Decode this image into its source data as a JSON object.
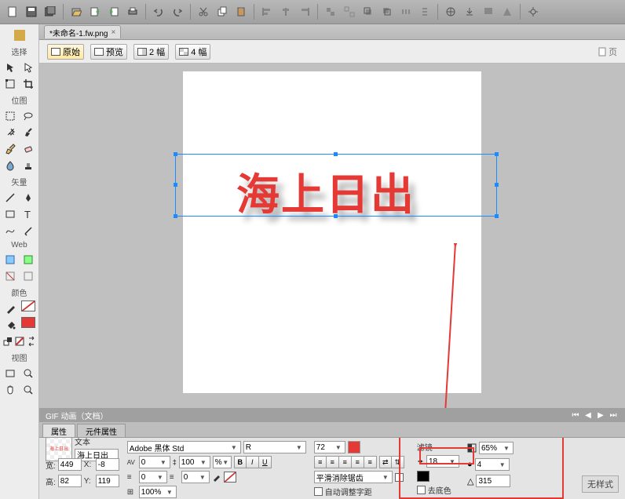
{
  "toolbar_icons": [
    "new",
    "save",
    "save-all",
    "open",
    "export",
    "import",
    "print",
    "undo",
    "redo",
    "cut",
    "copy",
    "paste",
    "clipboard",
    "align-left",
    "align-center",
    "align-right",
    "group",
    "ungroup",
    "front",
    "back",
    "distribute-h",
    "distribute-v",
    "launch",
    "download",
    "preview",
    "warn",
    "settings"
  ],
  "tools": {
    "section1": "选择",
    "section2": "位图",
    "section3": "矢量",
    "section4": "Web",
    "section5": "颜色",
    "section6": "视图"
  },
  "document": {
    "tab": "*未命名-1.fw.png"
  },
  "viewbar": {
    "original": "原始",
    "preview": "预览",
    "two_up": "2 幅",
    "four_up": "4 幅",
    "page_ind": "页"
  },
  "canvas": {
    "text": "海上日出"
  },
  "timeline": {
    "title": "GIF 动画（文档）"
  },
  "prop_tabs": {
    "properties": "属性",
    "component_properties": "元件属性"
  },
  "properties": {
    "type": "文本",
    "name": "海上日出",
    "font": "Adobe 黑体 Std",
    "font_style": "R",
    "font_size": "72",
    "av": "0",
    "tracking_pct": "100%",
    "antialias": "平滑消除锯齿",
    "auto_kerning": "自动调整字距",
    "remove_bg": "去底色",
    "w": "449",
    "x": "-8",
    "h": "82",
    "y": "119",
    "leading": "100",
    "indent1": "0",
    "indent2": "0",
    "color_stroke": "none",
    "color_fill": "#e53935",
    "filter_distance": "18",
    "filter_opacity": "65%",
    "filter_softness": "4",
    "filter_angle": "315",
    "filter_label": "滤镜",
    "no_style": "无样式",
    "w_label": "宽:",
    "x_label": "X:",
    "h_label": "高:",
    "y_label": "Y:"
  }
}
